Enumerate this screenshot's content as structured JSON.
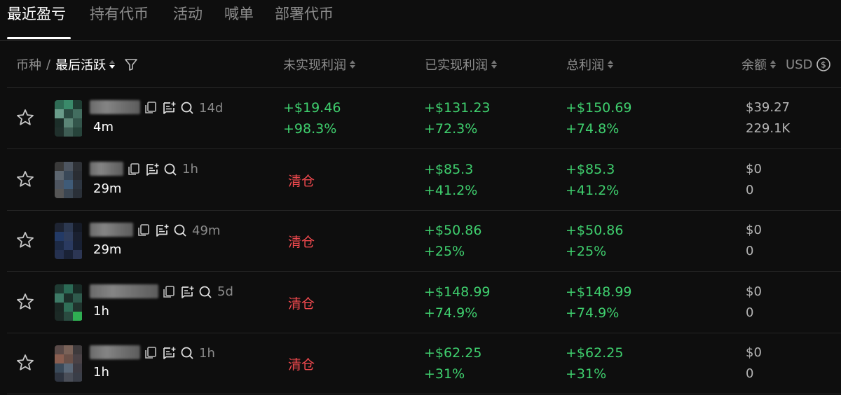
{
  "tabs": [
    "最近盈亏",
    "持有代币",
    "活动",
    "喊单",
    "部署代币"
  ],
  "header": {
    "token": "币种",
    "sep": "/",
    "last_active": "最后活跃",
    "unrealized": "未实现利润",
    "realized": "已实现利润",
    "total": "总利润",
    "balance": "余额",
    "currency": "USD"
  },
  "colors": {
    "profit": "#3fcf6e",
    "closed": "#f0494e",
    "background": "#0e0e0e"
  },
  "rows": [
    {
      "age": "14d",
      "last_active": "4m",
      "unrealized": "+$19.46",
      "unrealized_pct": "+98.3%",
      "status": "",
      "realized": "+$131.23",
      "realized_pct": "+72.3%",
      "total": "+$150.69",
      "total_pct": "+74.8%",
      "balance": "$39.27",
      "amount": "229.1K"
    },
    {
      "age": "1h",
      "last_active": "29m",
      "unrealized": "",
      "unrealized_pct": "",
      "status": "清仓",
      "realized": "+$85.3",
      "realized_pct": "+41.2%",
      "total": "+$85.3",
      "total_pct": "+41.2%",
      "balance": "$0",
      "amount": "0"
    },
    {
      "age": "49m",
      "last_active": "29m",
      "unrealized": "",
      "unrealized_pct": "",
      "status": "清仓",
      "realized": "+$50.86",
      "realized_pct": "+25%",
      "total": "+$50.86",
      "total_pct": "+25%",
      "balance": "$0",
      "amount": "0"
    },
    {
      "age": "5d",
      "last_active": "1h",
      "unrealized": "",
      "unrealized_pct": "",
      "status": "清仓",
      "realized": "+$148.99",
      "realized_pct": "+74.9%",
      "total": "+$148.99",
      "total_pct": "+74.9%",
      "balance": "$0",
      "amount": "0"
    },
    {
      "age": "1h",
      "last_active": "1h",
      "unrealized": "",
      "unrealized_pct": "",
      "status": "清仓",
      "realized": "+$62.25",
      "realized_pct": "+31%",
      "total": "+$62.25",
      "total_pct": "+31%",
      "balance": "$0",
      "amount": "0"
    }
  ]
}
